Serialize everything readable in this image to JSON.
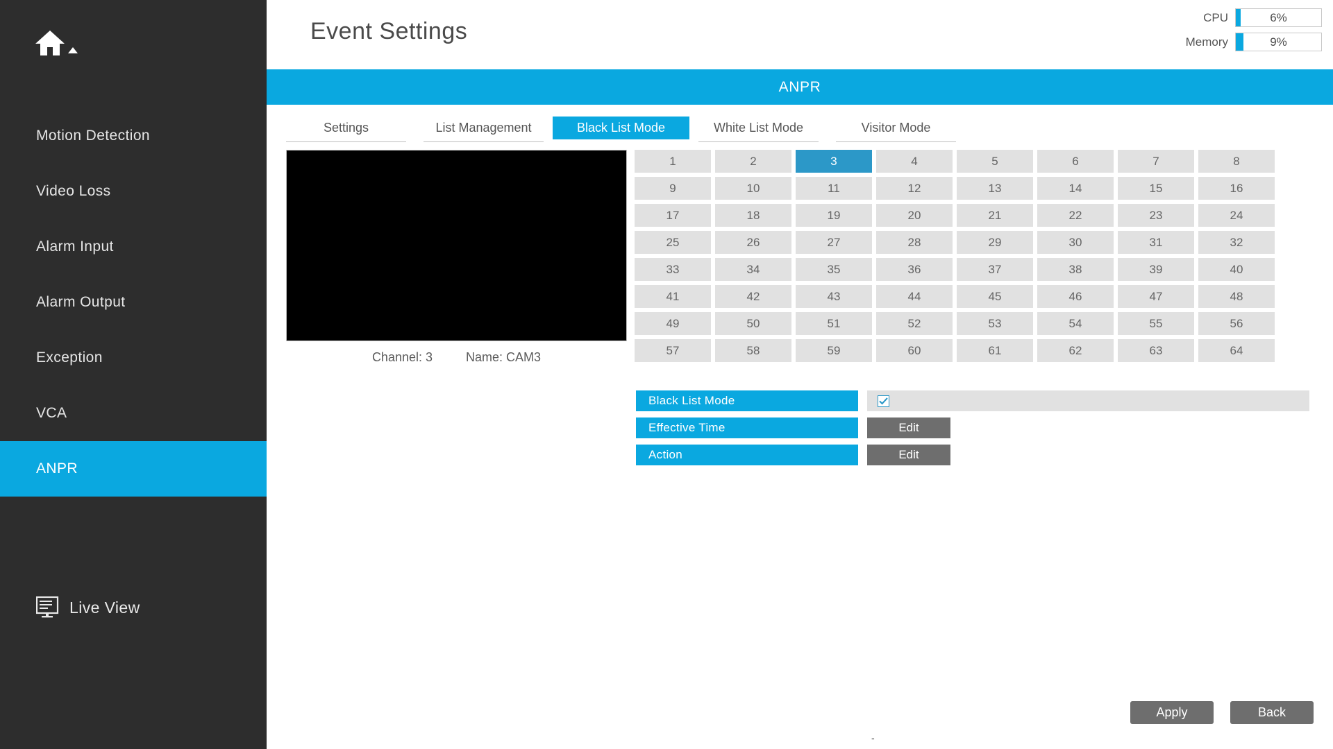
{
  "header": {
    "page_title": "Event Settings",
    "meters": [
      {
        "label": "CPU",
        "value": "6%",
        "percent": 6
      },
      {
        "label": "Memory",
        "value": "9%",
        "percent": 9
      }
    ]
  },
  "sidebar": {
    "home_icon": "home-icon",
    "items": [
      {
        "label": "Motion Detection",
        "active": false
      },
      {
        "label": "Video Loss",
        "active": false
      },
      {
        "label": "Alarm Input",
        "active": false
      },
      {
        "label": "Alarm Output",
        "active": false
      },
      {
        "label": "Exception",
        "active": false
      },
      {
        "label": "VCA",
        "active": false
      },
      {
        "label": "ANPR",
        "active": true
      }
    ],
    "live_view": {
      "label": "Live View",
      "icon": "monitor-icon"
    }
  },
  "banner": {
    "title": "ANPR",
    "color": "#0aa8e0"
  },
  "tabs": [
    {
      "label": "Settings",
      "active": false
    },
    {
      "label": "List Management",
      "active": false
    },
    {
      "label": "Black List Mode",
      "active": true
    },
    {
      "label": "White List Mode",
      "active": false
    },
    {
      "label": "Visitor Mode",
      "active": false
    }
  ],
  "preview": {
    "channel_text": "Channel: 3",
    "name_text": "Name: CAM3"
  },
  "channel_grid": {
    "selected": 3,
    "columns": 8,
    "cells": [
      "1",
      "2",
      "3",
      "4",
      "5",
      "6",
      "7",
      "8",
      "9",
      "10",
      "11",
      "12",
      "13",
      "14",
      "15",
      "16",
      "17",
      "18",
      "19",
      "20",
      "21",
      "22",
      "23",
      "24",
      "25",
      "26",
      "27",
      "28",
      "29",
      "30",
      "31",
      "32",
      "33",
      "34",
      "35",
      "36",
      "37",
      "38",
      "39",
      "40",
      "41",
      "42",
      "43",
      "44",
      "45",
      "46",
      "47",
      "48",
      "49",
      "50",
      "51",
      "52",
      "53",
      "54",
      "55",
      "56",
      "57",
      "58",
      "59",
      "60",
      "61",
      "62",
      "63",
      "64"
    ]
  },
  "settings": {
    "rows": [
      {
        "label": "Black List Mode",
        "control": "checkbox",
        "checked": true
      },
      {
        "label": "Effective Time",
        "control": "button",
        "button_label": "Edit"
      },
      {
        "label": "Action",
        "control": "button",
        "button_label": "Edit"
      }
    ]
  },
  "footer": {
    "apply_label": "Apply",
    "back_label": "Back",
    "bottom_mark": "-"
  },
  "colors": {
    "accent": "#0aa8e0",
    "accent_dark": "#2c98c8",
    "sidebar_bg": "#2d2d2d",
    "cell_bg": "#e1e1e1",
    "button_grey": "#6e6e6e"
  }
}
